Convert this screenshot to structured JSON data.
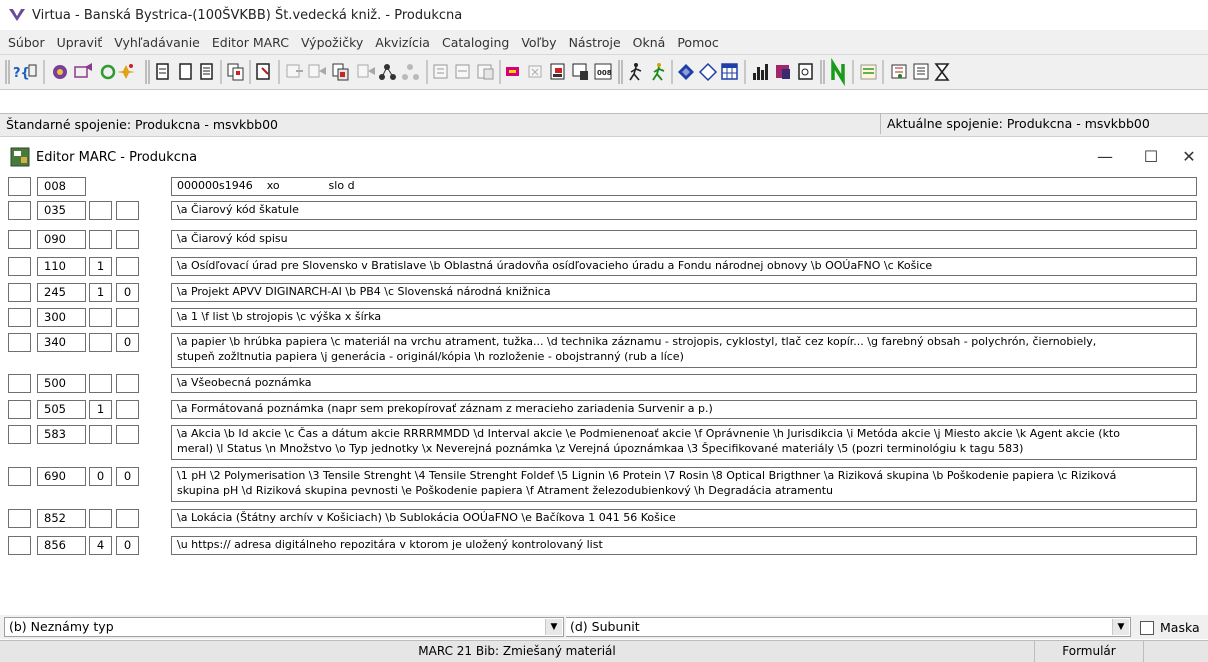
{
  "window": {
    "title": "Virtua - Banská Bystrica-(100ŠVKBB) Št.vedecká kniž. - Produkcna"
  },
  "menu": [
    "Súbor",
    "Upraviť",
    "Vyhľadávanie",
    "Editor MARC",
    "Výpožičky",
    "Akvizícia",
    "Cataloging",
    "Voľby",
    "Nástroje",
    "Okná",
    "Pomoc"
  ],
  "connection": {
    "standard": "Štandarné spojenie: Produkcna - msvkbb00",
    "current": "Aktuálne spojenie: Produkcna - msvkbb00"
  },
  "editor": {
    "title": "Editor MARC - Produkcna",
    "minimize": "—",
    "maximize": "☐",
    "close": "✕",
    "rows": [
      {
        "tag": "008",
        "ind1": "",
        "ind2": "",
        "data": "000000s1946    xo              slo d"
      },
      {
        "tag": "035",
        "ind1": "",
        "ind2": "",
        "data": "\\a Čiarový kód škatule"
      },
      {
        "tag": "090",
        "ind1": "",
        "ind2": "",
        "data": "\\a Čiarový kód spisu"
      },
      {
        "tag": "110",
        "ind1": "1",
        "ind2": "",
        "data": "\\a Osídľovací úrad pre Slovensko v Bratislave \\b Oblastná úradovňa osídľovacieho úradu a Fondu národnej obnovy \\b OOÚaFNO \\c Košice"
      },
      {
        "tag": "245",
        "ind1": "1",
        "ind2": "0",
        "data": "\\a Projekt APVV DIGINARCH-AI \\b PB4 \\c Slovenská národná knižnica"
      },
      {
        "tag": "300",
        "ind1": "",
        "ind2": "",
        "data": "\\a 1 \\f list \\b strojopis \\c výška x šírka"
      },
      {
        "tag": "340",
        "ind1": "",
        "ind2": "0",
        "data": "\\a papier \\b hrúbka papiera \\c materiál na vrchu atrament, tužka... \\d technika záznamu - strojopis, cyklostyl, tlač cez kopír... \\g farebný obsah - polychrón, čiernobiely,\nstupeň zožltnutia papiera \\j generácia - originál/kópia \\h rozloženie - obojstranný (rub a líce)"
      },
      {
        "tag": "500",
        "ind1": "",
        "ind2": "",
        "data": "\\a Všeobecná poznámka"
      },
      {
        "tag": "505",
        "ind1": "1",
        "ind2": "",
        "data": "\\a Formátovaná poznámka (napr sem prekopírovať záznam z meracieho zariadenia Survenir a p.)"
      },
      {
        "tag": "583",
        "ind1": "",
        "ind2": "",
        "data": "\\a Akcia \\b Id akcie \\c Čas a dátum akcie RRRRMMDD \\d Interval akcie \\e Podmienenoať akcie \\f Oprávnenie \\h Jurisdikcia \\i Metóda akcie \\j Miesto akcie \\k Agent akcie (kto\nmeral) \\l Status \\n Množstvo \\o Typ jednotky \\x Neverejná poznámka \\z Verejná úpoznámkaa \\3 Špecifikované materiály \\5 (pozri terminológiu k tagu 583)"
      },
      {
        "tag": "690",
        "ind1": "0",
        "ind2": "0",
        "data": "\\1 pH \\2 Polymerisation \\3 Tensile Strenght \\4 Tensile Strenght Foldef \\5 Lignin \\6 Protein \\7 Rosin \\8 Optical Brigthner \\a Riziková skupina \\b Poškodenie papiera \\c Riziková\nskupina pH \\d Riziková skupina pevnosti \\e Poškodenie papiera \\f Atrament železodubienkový \\h Degradácia atramentu"
      },
      {
        "tag": "852",
        "ind1": "",
        "ind2": "",
        "data": "\\a Lokácia (Štátny archív v Košiciach) \\b Sublokácia OOÚaFNO \\e Bačíkova 1 041 56 Košice"
      },
      {
        "tag": "856",
        "ind1": "4",
        "ind2": "0",
        "data": "\\u https:// adresa digitálneho repozitára v ktorom je uložený kontrolovaný list"
      }
    ]
  },
  "bottom": {
    "type_select": "(b) Neznámy typ",
    "subunit_select": "(d) Subunit",
    "mask_label": "Maska"
  },
  "status": {
    "main": "MARC 21 Bib: Zmiešaný materiál",
    "mode": "Formulár"
  },
  "colors": {
    "toolbar_bg": "#f0f0f0",
    "status_bg": "#e6e6e6"
  }
}
